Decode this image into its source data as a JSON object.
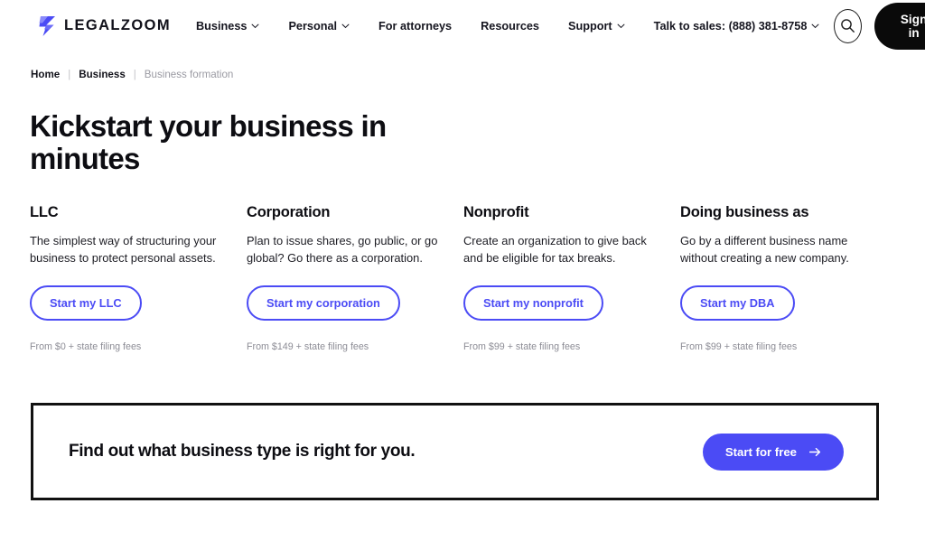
{
  "header": {
    "brand": {
      "logo_icon": "legalzoom-z-lightning-icon",
      "wordmark": "LEGALZOOM"
    },
    "nav_items": [
      {
        "label": "Business",
        "has_chevron": true
      },
      {
        "label": "Personal",
        "has_chevron": true
      },
      {
        "label": "For attorneys",
        "has_chevron": false
      },
      {
        "label": "Resources",
        "has_chevron": false
      },
      {
        "label": "Support",
        "has_chevron": true
      },
      {
        "label": "Talk to sales: (888) 381-8758",
        "has_chevron": true
      }
    ],
    "search_icon": "search-icon",
    "signin_label": "Sign in"
  },
  "breadcrumb": {
    "items": [
      {
        "label": "Home",
        "current": false
      },
      {
        "label": "Business",
        "current": false
      },
      {
        "label": "Business formation",
        "current": true
      }
    ],
    "separator": "|"
  },
  "hero": {
    "title": "Kickstart your business in minutes"
  },
  "cards": [
    {
      "title": "LLC",
      "description": "The simplest way of structuring your business to protect personal assets.",
      "cta_label": "Start my LLC",
      "price_note": "From $0 + state filing fees"
    },
    {
      "title": "Corporation",
      "description": "Plan to issue shares, go public, or go global? Go there as a corporation.",
      "cta_label": "Start my corporation",
      "price_note": "From $149 + state filing fees"
    },
    {
      "title": "Nonprofit",
      "description": "Create an organization to give back and be eligible for tax breaks.",
      "cta_label": "Start my nonprofit",
      "price_note": "From $99 + state filing fees"
    },
    {
      "title": "Doing business as",
      "description": "Go by a different business name without creating a new company.",
      "cta_label": "Start my DBA",
      "price_note": "From $99 + state filing fees"
    }
  ],
  "banner": {
    "headline": "Find out what business type is right for you.",
    "cta_label": "Start for free",
    "cta_icon": "arrow-right-icon"
  },
  "colors": {
    "brand_blue": "#4B4BF5",
    "logo_blue_light": "#8A8AFA",
    "black": "#0A0A0A",
    "muted_gray": "#8C8C95",
    "breadcrumb_gray": "#9A9AA2",
    "page_bg": "#FFFFFF"
  }
}
